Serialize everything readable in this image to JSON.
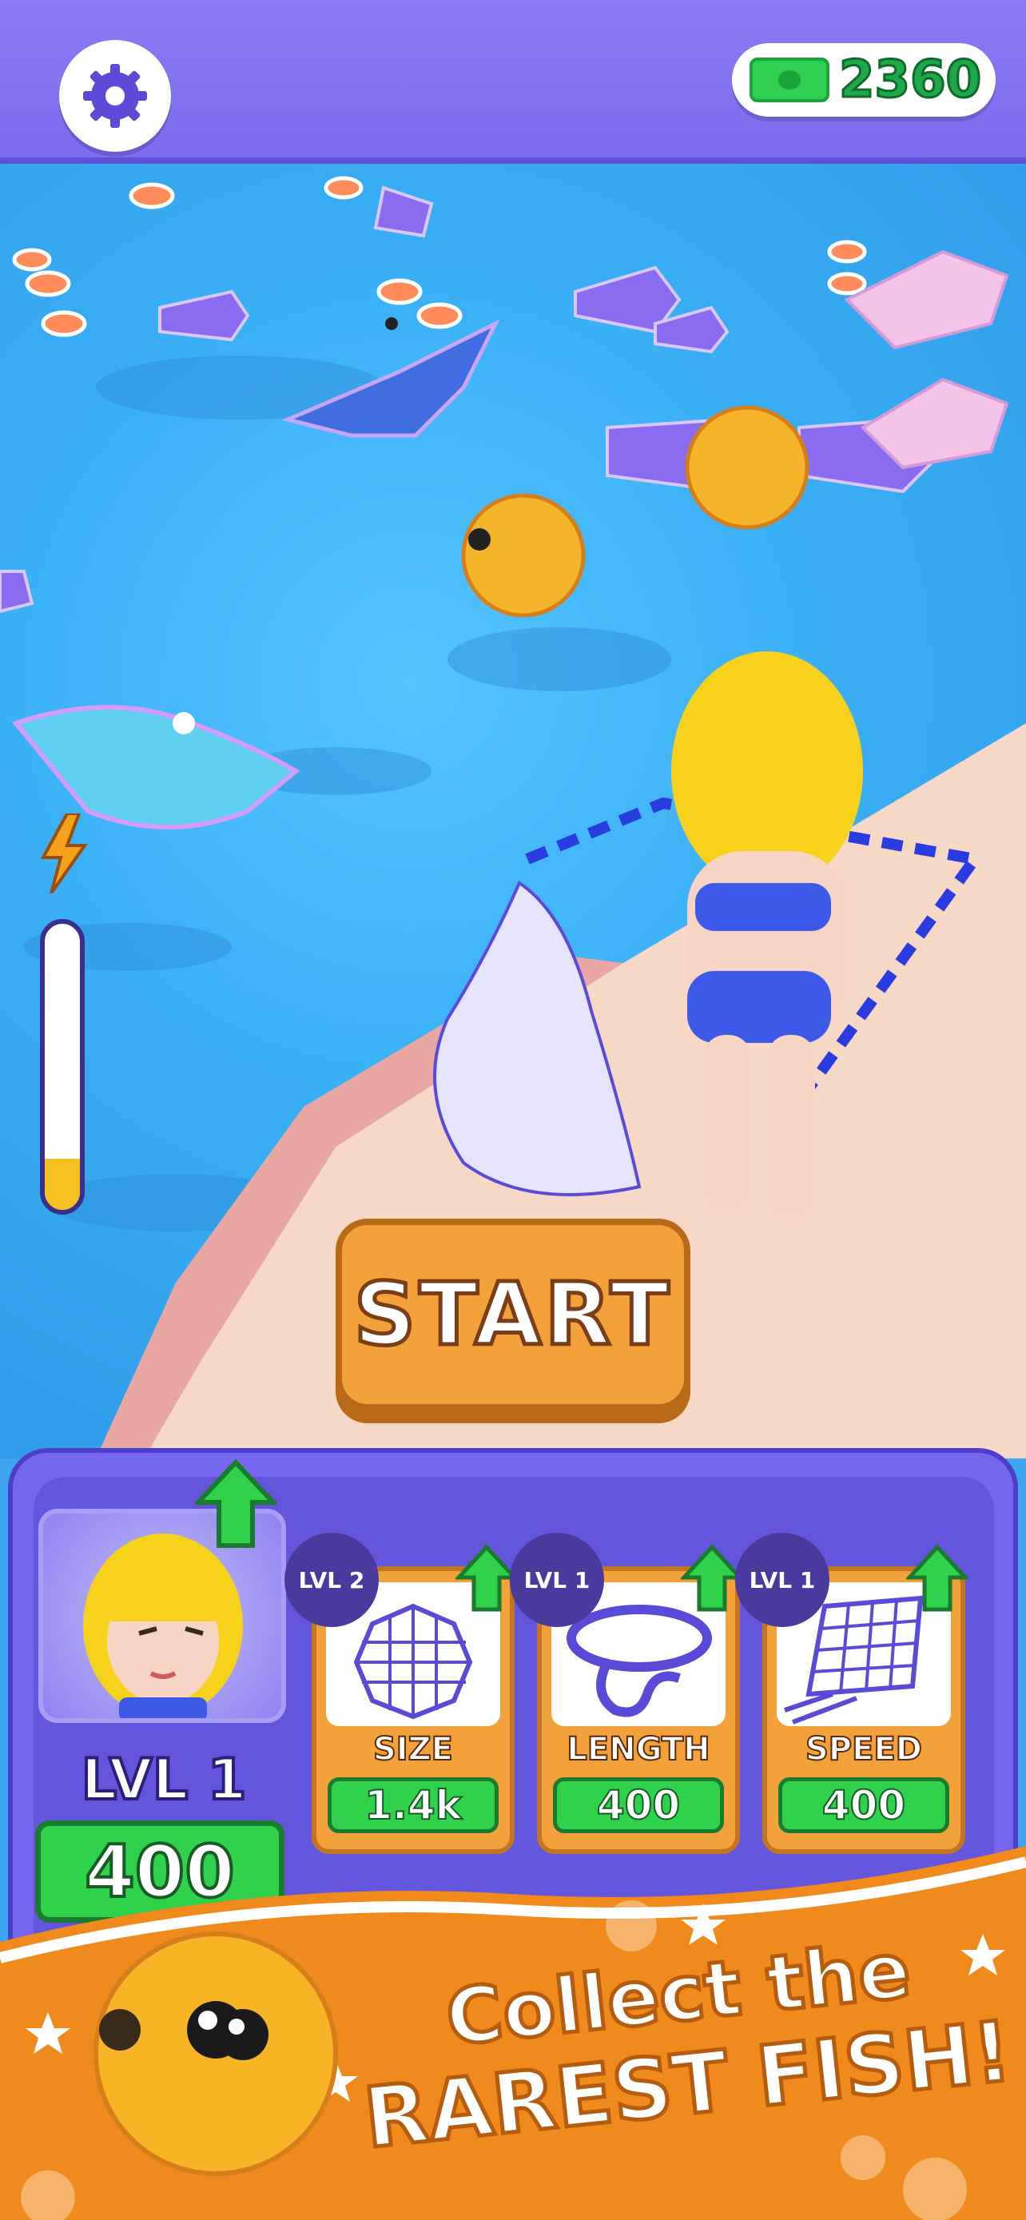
{
  "header": {
    "settings_icon": "gear-icon",
    "currency_icon": "cash-bill-icon",
    "currency_amount": "2360"
  },
  "game": {
    "energy_icon": "lightning-icon",
    "energy_level": 0.18,
    "start_label": "START"
  },
  "upgrades": {
    "character": {
      "icon": "character-portrait",
      "level_label": "LVL 1",
      "price": "400"
    },
    "cards": [
      {
        "level_label": "LVL 2",
        "name": "SIZE",
        "price": "1.4k",
        "icon": "net-size-icon"
      },
      {
        "level_label": "LVL 1",
        "name": "LENGTH",
        "price": "400",
        "icon": "rope-length-icon"
      },
      {
        "level_label": "LVL 1",
        "name": "SPEED",
        "price": "400",
        "icon": "net-speed-icon"
      }
    ]
  },
  "promo": {
    "line1": "Collect the",
    "line2": "RAREST FISH!"
  },
  "colors": {
    "header": "#7b6cf0",
    "sea": "#3ab0f6",
    "start_button": "#f3a13a",
    "price_green": "#2fd24a",
    "banner_orange": "#f08a1c"
  }
}
